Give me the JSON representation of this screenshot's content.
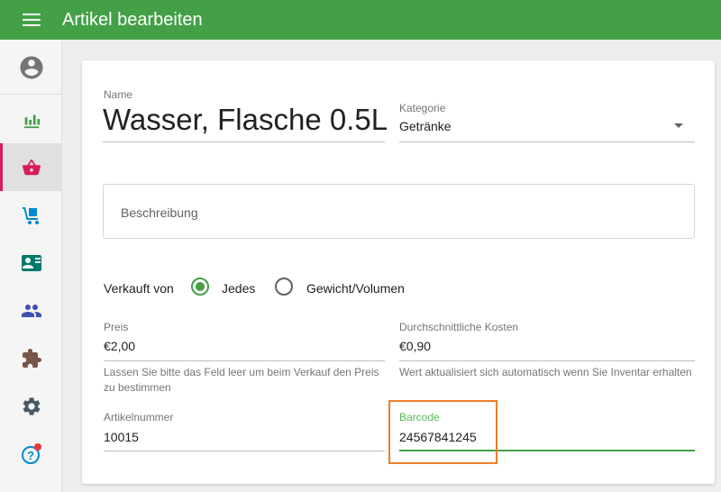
{
  "appbar": {
    "title": "Artikel bearbeiten",
    "menu_icon": "menu-icon",
    "color": "#43a047"
  },
  "sidebar": {
    "items": [
      {
        "name": "account-icon",
        "color": "#757575"
      },
      {
        "name": "bar-chart-icon",
        "color": "#43a047"
      },
      {
        "name": "basket-icon",
        "color": "#d81b60",
        "active": true
      },
      {
        "name": "hand-truck-icon",
        "color": "#0288d1"
      },
      {
        "name": "contact-card-icon",
        "color": "#00796b"
      },
      {
        "name": "people-icon",
        "color": "#3f51b5"
      },
      {
        "name": "puzzle-icon",
        "color": "#795548"
      },
      {
        "name": "gear-icon",
        "color": "#455a64"
      },
      {
        "name": "help-icon",
        "color": "#0288d1",
        "badge_color": "#e53935"
      }
    ]
  },
  "form": {
    "name": {
      "label": "Name",
      "value": "Wasser, Flasche 0.5L"
    },
    "category": {
      "label": "Kategorie",
      "value": "Getränke"
    },
    "description": {
      "placeholder": "Beschreibung"
    },
    "sold_by": {
      "label": "Verkauft von",
      "options": [
        "Jedes",
        "Gewicht/Volumen"
      ],
      "selected": "Jedes"
    },
    "price": {
      "label": "Preis",
      "value": "€2,00",
      "hint": "Lassen Sie bitte das Feld leer um beim Verkauf den Preis zu bestimmen"
    },
    "avg_cost": {
      "label": "Durchschnittliche Kosten",
      "value": "€0,90",
      "hint": "Wert aktualisiert sich automatisch wenn Sie Inventar erhalten"
    },
    "article_number": {
      "label": "Artikelnummer",
      "value": "10015"
    },
    "barcode": {
      "label": "Barcode",
      "value": "24567841245"
    }
  },
  "colors": {
    "accent": "#43a047",
    "highlight": "#ee7d2b"
  }
}
